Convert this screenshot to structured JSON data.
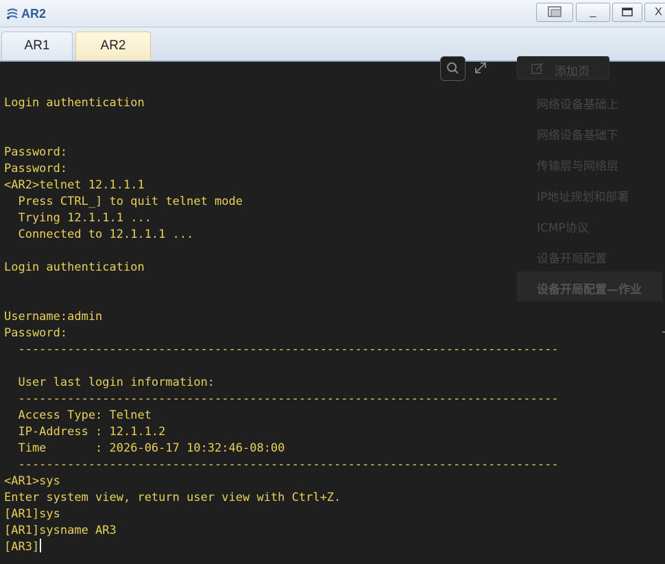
{
  "window": {
    "title": "AR2"
  },
  "titlebar_buttons": {
    "minimize": "_",
    "close": "X"
  },
  "tabs": [
    {
      "label": "AR1",
      "active": false
    },
    {
      "label": "AR2",
      "active": true
    }
  ],
  "terminal": {
    "text_color": "#e8d25a",
    "background": "#1f1f1f",
    "lines": [
      "Login authentication",
      "",
      "",
      "Password:",
      "Password:",
      "<AR2>telnet 12.1.1.1",
      "  Press CTRL_] to quit telnet mode",
      "  Trying 12.1.1.1 ...",
      "  Connected to 12.1.1.1 ...",
      "",
      "Login authentication",
      "",
      "",
      "Username:admin",
      "Password:",
      "  -----------------------------------------------------------------------------",
      "",
      "  User last login information:",
      "  -----------------------------------------------------------------------------",
      "  Access Type: Telnet",
      "  IP-Address : 12.1.1.2",
      "  Time       : 2026-06-17 10:32:46-08:00",
      "  -----------------------------------------------------------------------------",
      "<AR1>sys",
      "Enter system view, return user view with Ctrl+Z.",
      "[AR1]sys",
      "[AR1]sysname AR3",
      "[AR3]"
    ]
  },
  "overlay": {
    "add_page_label": "添加页",
    "items": [
      {
        "label": "网络设备基础上",
        "active": false
      },
      {
        "label": "网络设备基础下",
        "active": false
      },
      {
        "label": "传输层与网络层",
        "active": false
      },
      {
        "label": "IP地址规划和部署",
        "active": false
      },
      {
        "label": "ICMP协议",
        "active": false
      },
      {
        "label": "设备开局配置",
        "active": false
      },
      {
        "label": "设备开局配置—作业",
        "active": true
      }
    ]
  }
}
